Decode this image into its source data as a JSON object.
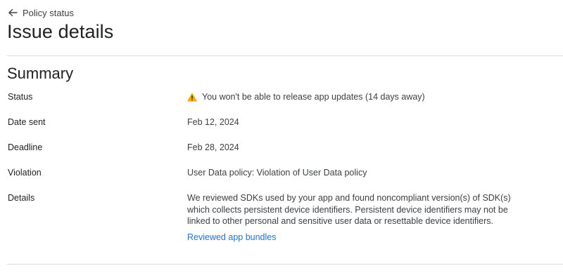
{
  "header": {
    "back_label": "Policy status",
    "title": "Issue details"
  },
  "summary": {
    "heading": "Summary",
    "status": {
      "label": "Status",
      "value": "You won't be able to release app updates (14 days away)",
      "icon": "warning-icon",
      "icon_color": "#f9ab00"
    },
    "date_sent": {
      "label": "Date sent",
      "value": "Feb 12, 2024"
    },
    "deadline": {
      "label": "Deadline",
      "value": "Feb 28, 2024"
    },
    "violation": {
      "label": "Violation",
      "value": "User Data policy: Violation of User Data policy"
    },
    "details": {
      "label": "Details",
      "value": "We reviewed SDKs used by your app and found noncompliant version(s) of SDK(s) which collects persistent device identifiers. Persistent device identifiers may not be linked to other personal and sensitive user data or resettable device identifiers.",
      "link_label": "Reviewed app bundles",
      "link_color": "#1a73e8"
    }
  }
}
